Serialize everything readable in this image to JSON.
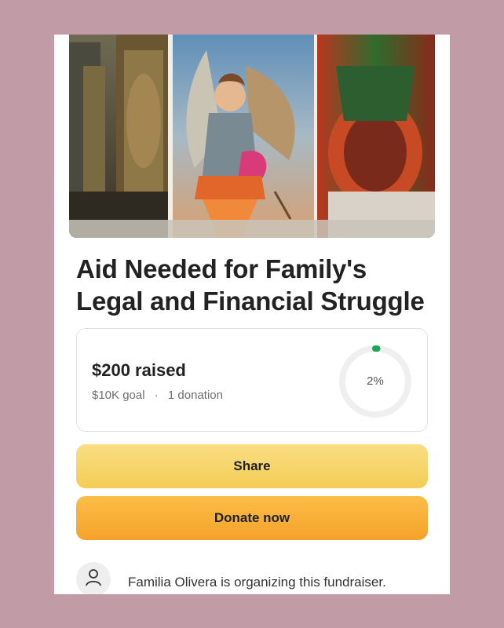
{
  "fundraiser": {
    "title": "Aid Needed for Family's Legal and Financial Struggle",
    "raised": "$200 raised",
    "goal": "$10K goal",
    "separator": "·",
    "donations": "1 donation",
    "progress_label": "2%",
    "progress": 0.02,
    "organizer_text": "Familia Olivera is organizing this fundraiser."
  },
  "actions": {
    "share_label": "Share",
    "donate_label": "Donate now"
  },
  "colors": {
    "background": "#c19ca6",
    "share_button": "#f4cd55",
    "donate_button": "#f5a22a",
    "progress_fill": "#1fa659",
    "progress_track": "#efefef"
  },
  "icons": {
    "organizer_avatar": "person-icon"
  }
}
